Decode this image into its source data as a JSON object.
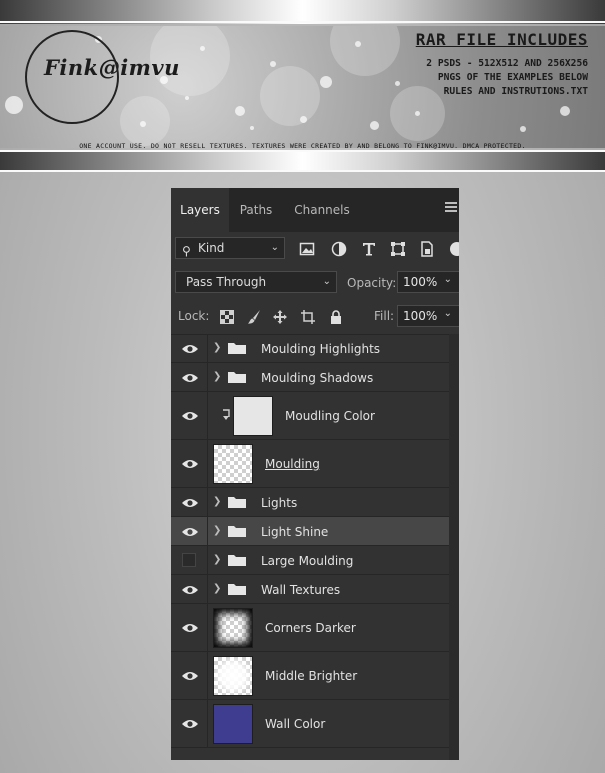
{
  "banner": {
    "logo_text": "Fink@imvu",
    "rar_title": "RAR FILE INCLUDES",
    "rar_lines": [
      "2 PSDS - 512X512 AND 256X256",
      "PNGS OF THE EXAMPLES BELOW",
      "RULES AND INSTRUTIONS.TXT"
    ],
    "disclaimer": "ONE ACCOUNT USE. DO NOT RESELL TEXTURES. TEXTURES WERE CREATED BY AND BELONG TO FINK@IMVU. DMCA PROTECTED."
  },
  "panel": {
    "tabs": [
      {
        "label": "Layers",
        "active": true
      },
      {
        "label": "Paths",
        "active": false
      },
      {
        "label": "Channels",
        "active": false
      }
    ],
    "filter": {
      "kind_label": "Kind"
    },
    "blend_mode": "Pass Through",
    "opacity_label": "Opacity:",
    "opacity_value": "100%",
    "lock_label": "Lock:",
    "fill_label": "Fill:",
    "fill_value": "100%",
    "layers": [
      {
        "name": "Moulding Highlights",
        "type": "group",
        "visible": true
      },
      {
        "name": "Moulding Shadows",
        "type": "group",
        "visible": true
      },
      {
        "name": "Moudling Color",
        "type": "clipped-fill",
        "visible": true,
        "thumb_color": "#e6e6e6"
      },
      {
        "name": "Moulding",
        "type": "layer",
        "visible": true
      },
      {
        "name": "Lights",
        "type": "group",
        "visible": true
      },
      {
        "name": "Light Shine",
        "type": "group",
        "visible": true,
        "selected": true
      },
      {
        "name": "Large Moulding",
        "type": "group",
        "visible": false
      },
      {
        "name": "Wall Textures",
        "type": "group",
        "visible": true
      },
      {
        "name": "Corners Darker",
        "type": "layer",
        "visible": true
      },
      {
        "name": "Middle Brighter",
        "type": "layer",
        "visible": true
      },
      {
        "name": "Wall Color",
        "type": "fill",
        "visible": true,
        "thumb_color": "#3f3d8f"
      }
    ]
  },
  "colors": {
    "panel_bg": "#323232",
    "selected_row": "#474747",
    "wall_color": "#3f3d8f"
  }
}
